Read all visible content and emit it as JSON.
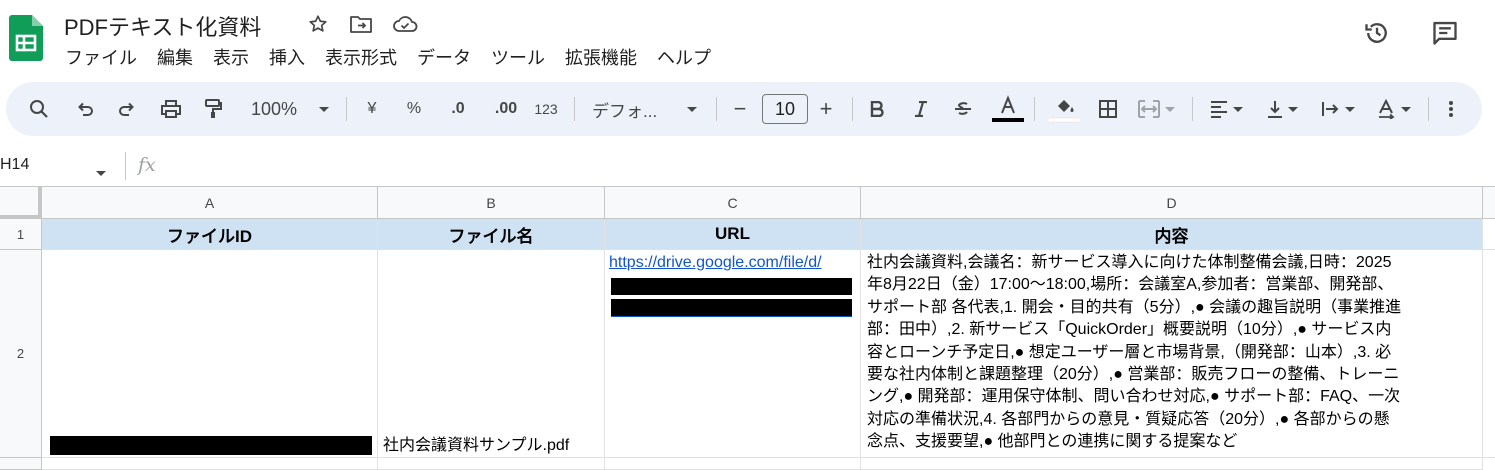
{
  "app": {
    "doc_title": "PDFテキスト化資料"
  },
  "menu": [
    "ファイル",
    "編集",
    "表示",
    "挿入",
    "表示形式",
    "データ",
    "ツール",
    "拡張機能",
    "ヘルプ"
  ],
  "toolbar": {
    "zoom": "100%",
    "currency": "¥",
    "percent": "%",
    "decimal_decrease": ".0",
    "decimal_increase": ".00",
    "number_format": "123",
    "font_name": "デフォ...",
    "font_size": "10",
    "minus": "−",
    "plus": "+"
  },
  "formula_bar": {
    "name_box": "H14",
    "fx": "fx"
  },
  "sheet": {
    "columns": [
      "A",
      "B",
      "C",
      "D"
    ],
    "rows": [
      "1",
      "2"
    ],
    "header": [
      "ファイルID",
      "ファイル名",
      "URL",
      "内容"
    ],
    "row2": {
      "file_name": "社内会議資料サンプル.pdf",
      "url_visible": "https://drive.google.com/file/d/",
      "content_lines": [
        "社内会議資料,会議名：新サービス導入に向けた体制整備会議,日時：2025",
        "年8月22日（金）17:00〜18:00,場所：会議室A,参加者：営業部、開発部、",
        "サポート部 各代表,1. 開会・目的共有（5分）,● 会議の趣旨説明（事業推進",
        "部：田中）,2. 新サービス「QuickOrder」概要説明（10分）,● サービス内",
        "容とローンチ予定日,● 想定ユーザー層と市場背景,（開発部：山本）,3. 必",
        "要な社内体制と課題整理（20分）,● 営業部：販売フローの整備、トレーニ",
        "ング,● 開発部：運用保守体制、問い合わせ対応,● サポート部：FAQ、一次",
        "対応の準備状況,4. 各部門からの意見・質疑応答（20分）,● 各部からの懸",
        "念点、支援要望,● 他部門との連携に関する提案など"
      ]
    }
  },
  "colors": {
    "header_fill": "#cfe2f3",
    "link": "#1155cc",
    "toolbar_bg": "#edf2fa",
    "logo_green": "#0f9d58"
  },
  "icons": [
    "sheets-logo",
    "star-icon",
    "move-to-folder-icon",
    "cloud-status-icon",
    "history-icon",
    "comment-icon",
    "search-icon",
    "undo-icon",
    "redo-icon",
    "print-icon",
    "paint-format-icon",
    "bold-icon",
    "italic-icon",
    "strikethrough-icon",
    "text-color-icon",
    "fill-color-icon",
    "borders-icon",
    "merge-cells-icon",
    "align-left-icon",
    "valign-bottom-icon",
    "text-wrap-icon",
    "text-rotation-icon",
    "more-vert-icon"
  ]
}
